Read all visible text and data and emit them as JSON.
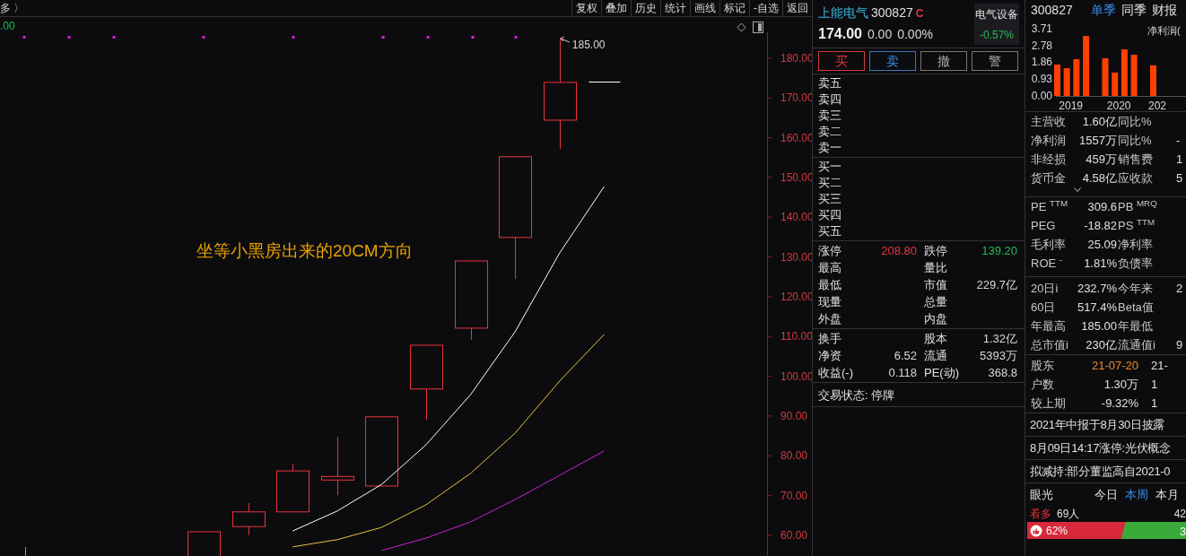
{
  "top_bar": {
    "left_text": "多 〉",
    "toolbar": [
      "复权",
      "叠加",
      "历史",
      "统计",
      "画线",
      "标记",
      "-自选",
      "返回"
    ]
  },
  "chart": {
    "corner_value": ".00",
    "note": "坐等小黑房出来的20CM方向",
    "peak_label": "185.00",
    "price_axis": [
      "180.00",
      "170.00",
      "160.00",
      "150.00",
      "140.00",
      "130.00",
      "120.00",
      "110.00",
      "100.00",
      "90.00",
      "80.00",
      "70.00",
      "60.00"
    ]
  },
  "quote": {
    "name": "上能电气",
    "code": "300827",
    "flag": "C",
    "sector": {
      "name": "电气设备",
      "change": "-0.57%"
    },
    "price": "174.00",
    "change": "0.00",
    "change_pct": "0.00%",
    "trade_buttons": [
      {
        "label": "买",
        "kind": "buy"
      },
      {
        "label": "卖",
        "kind": "sell"
      },
      {
        "label": "撤",
        "kind": "cancel"
      },
      {
        "label": "警",
        "kind": "alert"
      }
    ],
    "asks": [
      "卖五",
      "卖四",
      "卖三",
      "卖二",
      "卖一"
    ],
    "bids": [
      "买一",
      "买二",
      "买三",
      "买四",
      "买五"
    ],
    "stats": [
      {
        "label": "涨停",
        "value": "208.80",
        "color": "#e8343a"
      },
      {
        "label": "跌停",
        "value": "139.20",
        "color": "#1fbf4d"
      },
      {
        "label": "最高"
      },
      {
        "label": "量比"
      },
      {
        "label": "最低"
      },
      {
        "label": "市值",
        "value": "229.7亿"
      },
      {
        "label": "现量"
      },
      {
        "label": "总量"
      },
      {
        "label": "外盘"
      },
      {
        "label": "内盘"
      }
    ],
    "stats2": [
      {
        "label": "换手"
      },
      {
        "label": "股本",
        "value": "1.32亿"
      },
      {
        "label": "净资",
        "value": "6.52"
      },
      {
        "label": "流通",
        "value": "5393万"
      },
      {
        "label": "收益(-)",
        "value": "0.118"
      },
      {
        "label": "PE(动)",
        "value": "368.8"
      }
    ],
    "trade_status": "交易状态: 停牌"
  },
  "finance": {
    "code": "300827",
    "tabs": [
      {
        "label": "单季",
        "selected": true
      },
      {
        "label": "同季",
        "selected": false
      },
      {
        "label": "财报",
        "selected": false
      }
    ],
    "chart_data": {
      "type": "bar",
      "title": "净利润(",
      "categories": [
        null,
        "2019",
        null,
        null,
        null,
        null,
        "2020",
        null,
        null,
        null,
        "202"
      ],
      "series": [
        {
          "color": "#ff4000",
          "values": [
            1.73,
            1.53,
            2.03,
            3.31,
            null,
            2.08,
            1.29,
            2.57,
            2.27,
            null,
            1.69
          ]
        }
      ],
      "ylim": [
        0,
        3.71
      ],
      "yticks": [
        {
          "value": 3.71,
          "label": "3.71"
        },
        {
          "value": 2.78,
          "label": "2.78"
        },
        {
          "value": 1.86,
          "label": "1.86"
        },
        {
          "value": 0.93,
          "label": "0.93"
        },
        {
          "value": 0,
          "label": "0.00"
        }
      ]
    },
    "rows": [
      {
        "label": "主营收",
        "value": "1.60亿",
        "label2": "同比%"
      },
      {
        "label": "净利润",
        "value": "1557万",
        "label2": "同比%",
        "value2": "-"
      },
      {
        "label": "非经损",
        "value": "459万",
        "label2": "销售费",
        "value2": "1"
      },
      {
        "label": "货币金",
        "value": "4.58亿",
        "label2": "应收款",
        "value2": "5"
      }
    ],
    "valuation": [
      {
        "label": "PE $^{TTM}$",
        "value": "309.6",
        "label2": "PB $^{MRQ}$"
      },
      {
        "label": "PEG",
        "value": "-18.82",
        "label2": "PS $^{TTM}$"
      },
      {
        "label": "毛利率",
        "value": "25.09",
        "label2": "净利率"
      },
      {
        "label": "ROE $^{-}$",
        "value": "1.81%",
        "label2": "负债率"
      }
    ],
    "performance": [
      {
        "label": "20日i",
        "value": "232.7%",
        "label2": "今年来",
        "value2": "2"
      },
      {
        "label": "60日",
        "value": "517.4%",
        "label2": "Beta值"
      },
      {
        "label": "年最高",
        "value": "185.00",
        "label2": "年最低"
      },
      {
        "label": "总市值i",
        "value": "230亿",
        "label2": "流通值i",
        "value2": "9"
      }
    ],
    "holders": [
      {
        "label": "股东",
        "value": "21-07-20",
        "value2": "21-",
        "highlight": true
      },
      {
        "label": "户数",
        "value": "1.30万",
        "value2": "1",
        "highlight": false
      },
      {
        "label": "较上期",
        "value": "-9.32%",
        "value2": "1",
        "highlight": false
      }
    ],
    "news": [
      "2021年中报于8月30日披露",
      "8月09日14:17涨停:光伏概念",
      "拟减持:部分董监高自2021-0"
    ],
    "vision": {
      "title": "眼光",
      "periods": [
        {
          "label": "今日",
          "selected": false
        },
        {
          "label": "本周",
          "selected": true
        },
        {
          "label": "本月",
          "selected": false
        }
      ],
      "bull_label": "看多",
      "bull_count": "69人",
      "bear_count": "42",
      "bull_pct": "62%",
      "bear_pct": "3",
      "level": 0.62
    }
  }
}
